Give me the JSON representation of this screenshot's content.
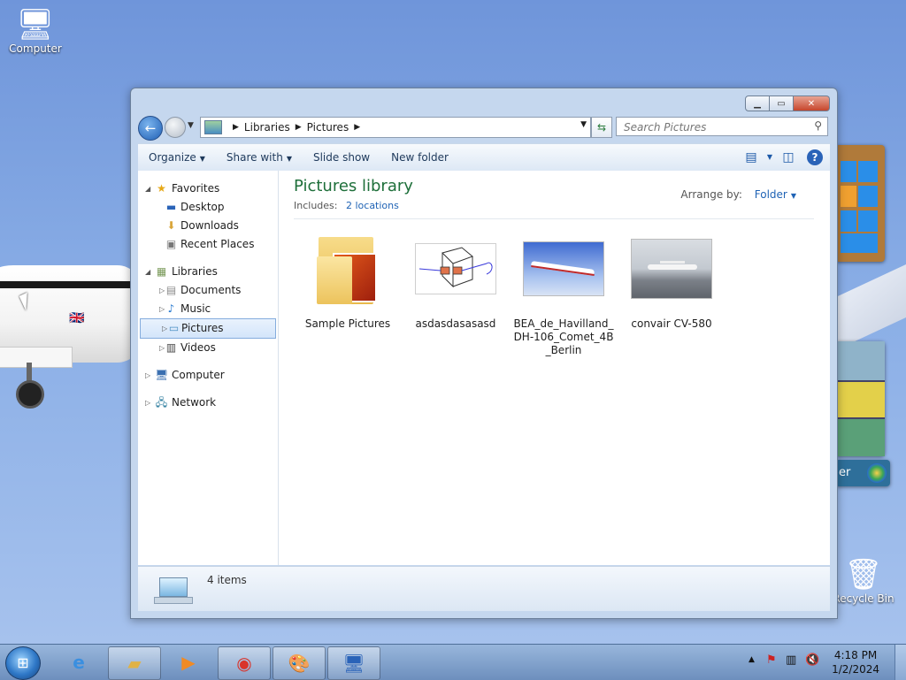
{
  "desktop": {
    "computer_label": "Computer",
    "recycle_label": "Recycle Bin",
    "gadget_label": "er"
  },
  "window": {
    "address": {
      "crumbs": [
        "Libraries",
        "Pictures"
      ]
    },
    "search": {
      "placeholder": "Search Pictures"
    },
    "toolbar": {
      "organize": "Organize",
      "share_with": "Share with",
      "slide_show": "Slide show",
      "new_folder": "New folder"
    },
    "nav": {
      "favorites": "Favorites",
      "desktop": "Desktop",
      "downloads": "Downloads",
      "recent_places": "Recent Places",
      "libraries": "Libraries",
      "documents": "Documents",
      "music": "Music",
      "pictures": "Pictures",
      "videos": "Videos",
      "computer": "Computer",
      "network": "Network"
    },
    "library": {
      "title": "Pictures library",
      "includes_label": "Includes:",
      "locations_link": "2 locations",
      "arrange_label": "Arrange by:",
      "arrange_value": "Folder"
    },
    "items": [
      {
        "name": "Sample Pictures"
      },
      {
        "name": "asdasdasasasd"
      },
      {
        "name": "BEA_de_Havilland_DH-106_Comet_4B_Berlin"
      },
      {
        "name": "convair CV-580"
      }
    ],
    "details": {
      "count": "4 items"
    }
  },
  "taskbar": {
    "clock_time": "4:18 PM",
    "clock_date": "1/2/2024"
  },
  "colors": {
    "title_green": "#1e6f3a",
    "link_blue": "#1f63b5",
    "selection_border": "#84acdd"
  }
}
